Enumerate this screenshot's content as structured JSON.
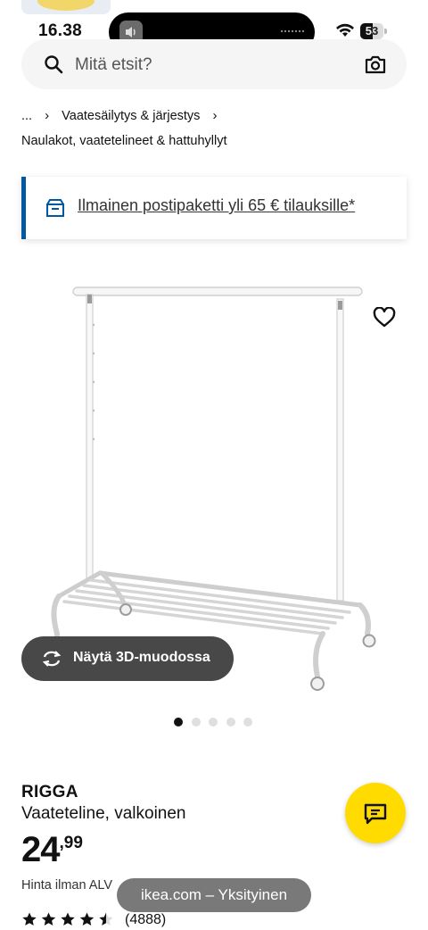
{
  "status_bar": {
    "time": "16.38",
    "battery": "53",
    "battery_level": 0.53
  },
  "search": {
    "placeholder": "Mitä etsit?"
  },
  "breadcrumb": {
    "ellipsis": "...",
    "parent": "Vaatesäilytys & järjestys",
    "current": "Naulakot, vaatetelineet & hattuhyllyt"
  },
  "banner": {
    "text": "Ilmainen postipaketti yli 65 € tilauksille*"
  },
  "gallery": {
    "view_3d_label": "Näytä 3D-muodossa",
    "image_count": 5,
    "active_index": 0
  },
  "product": {
    "name": "RIGGA",
    "description": "Vaateteline, valkoinen",
    "price_integer": "24",
    "price_decimals": ",99",
    "vat_note": "Hinta ilman ALV",
    "rating": 4.5,
    "review_count": "(4888)"
  },
  "browser": {
    "url_label": "ikea.com – Yksityinen"
  },
  "colors": {
    "accent_blue": "#0058a3",
    "accent_yellow": "#ffdb00"
  },
  "icons": [
    "volume-icon",
    "wifi-icon",
    "battery-icon",
    "search-icon",
    "camera-icon",
    "package-icon",
    "heart-icon",
    "rotate-3d-icon",
    "chat-icon",
    "star-icon"
  ]
}
